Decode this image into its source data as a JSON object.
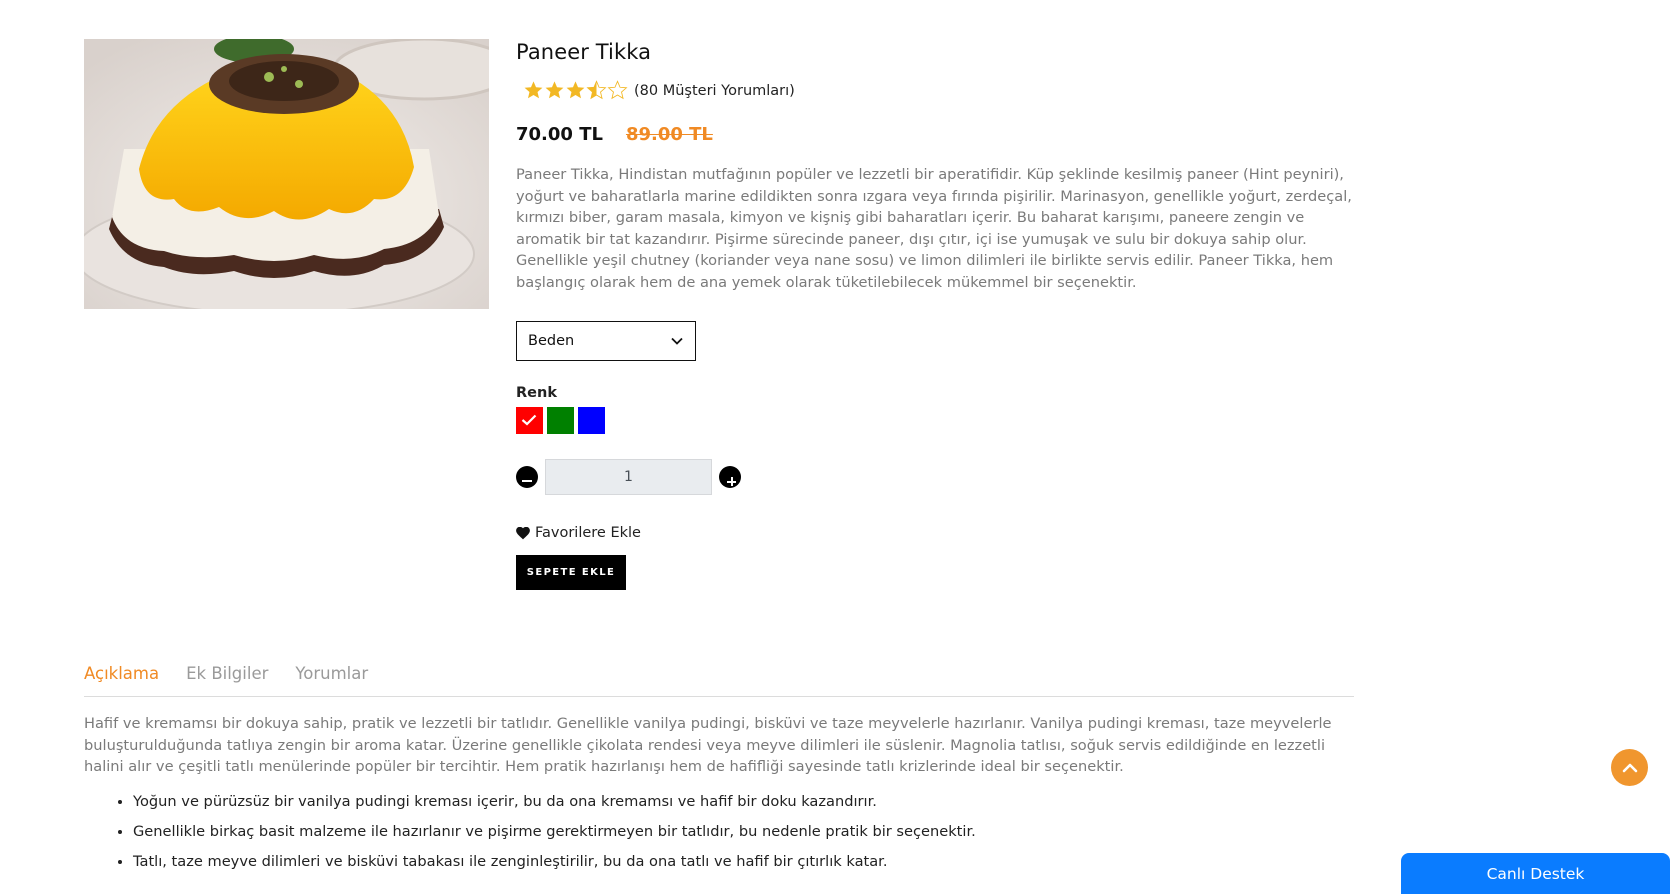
{
  "product": {
    "title": "Paneer Tikka",
    "rating": 3.5,
    "rating_max": 5,
    "review_count_text": "(80 Müşteri Yorumları)",
    "price_current": "70.00 TL",
    "price_old": "89.00 TL",
    "description": "Paneer Tikka, Hindistan mutfağının popüler ve lezzetli bir aperatifidir. Küp şeklinde kesilmiş paneer (Hint peyniri), yoğurt ve baharatlarla marine edildikten sonra ızgara veya fırında pişirilir. Marinasyon, genellikle yoğurt, zerdeçal, kırmızı biber, garam masala, kimyon ve kişniş gibi baharatları içerir. Bu baharat karışımı, paneere zengin ve aromatik bir tat kazandırır. Pişirme sürecinde paneer, dışı çıtır, içi ise yumuşak ve sulu bir dokuya sahip olur. Genellikle yeşil chutney (koriander veya nane sosu) ve limon dilimleri ile birlikte servis edilir. Paneer Tikka, hem başlangıç olarak hem de ana yemek olarak tüketilebilecek mükemmel bir seçenektir.",
    "size_select_value": "Beden",
    "color_label": "Renk",
    "colors": [
      "#ff0000",
      "#008000",
      "#0000ff"
    ],
    "selected_color_index": 0,
    "quantity": "1",
    "favorite_label": "Favorilere Ekle",
    "add_to_cart_label": "SEPETE EKLE"
  },
  "tabs": [
    {
      "label": "Açıklama",
      "active": true
    },
    {
      "label": "Ek Bilgiler",
      "active": false
    },
    {
      "label": "Yorumlar",
      "active": false
    }
  ],
  "tab_content": {
    "description": "Hafif ve kremamsı bir dokuya sahip, pratik ve lezzetli bir tatlıdır. Genellikle vanilya pudingi, bisküvi ve taze meyvelerle hazırlanır. Vanilya pudingi kreması, taze meyvelerle buluşturulduğunda tatlıya zengin bir aroma katar. Üzerine genellikle çikolata rendesi veya meyve dilimleri ile süslenir. Magnolia tatlısı, soğuk servis edildiğinde en lezzetli halini alır ve çeşitli tatlı menülerinde popüler bir tercihtir. Hem pratik hazırlanışı hem de hafifliği sayesinde tatlı krizlerinde ideal bir seçenektir.",
    "bullets": [
      "Yoğun ve pürüzsüz bir vanilya pudingi kreması içerir, bu da ona kremamsı ve hafif bir doku kazandırır.",
      "Genellikle birkaç basit malzeme ile hazırlanır ve pişirme gerektirmeyen bir tatlıdır, bu nedenle pratik bir seçenektir.",
      "Tatlı, taze meyve dilimleri ve bisküvi tabakası ile zenginleştirilir, bu da ona tatlı ve hafif bir çıtırlık katar."
    ]
  },
  "widgets": {
    "live_support_label": "Canlı Destek",
    "scroll_top_icon": "chevron-up-icon"
  },
  "colors": {
    "accent": "#f08a24",
    "live_support": "#0a7cff"
  }
}
